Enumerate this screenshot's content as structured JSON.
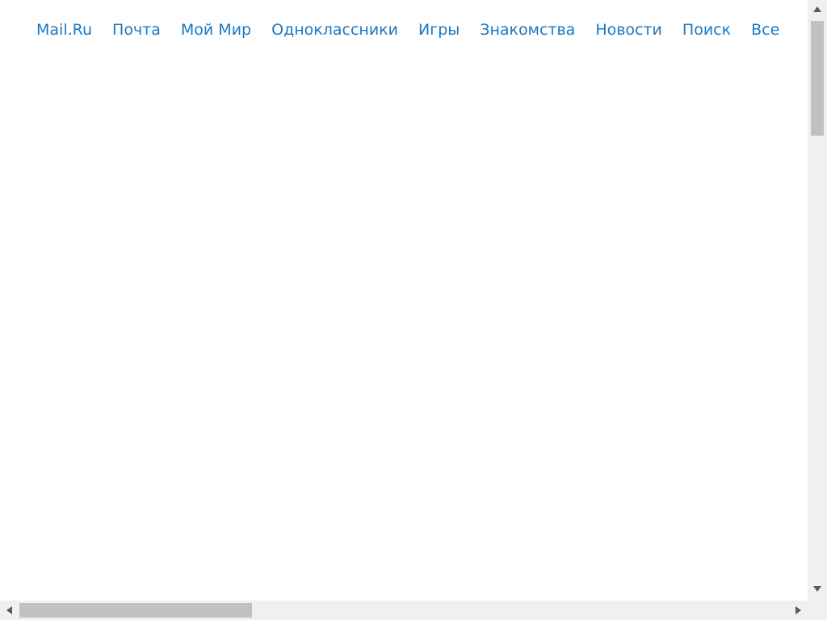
{
  "nav": {
    "items": [
      {
        "label": "Mail.Ru"
      },
      {
        "label": "Почта"
      },
      {
        "label": "Мой Мир"
      },
      {
        "label": "Одноклассники"
      },
      {
        "label": "Игры"
      },
      {
        "label": "Знакомства"
      },
      {
        "label": "Новости"
      },
      {
        "label": "Поиск"
      },
      {
        "label": "Все"
      }
    ]
  },
  "colors": {
    "link": "#1a78c2",
    "background": "#ffffff",
    "scrollbar_track": "#f0f0f0",
    "scrollbar_thumb": "#c1c1c1"
  }
}
